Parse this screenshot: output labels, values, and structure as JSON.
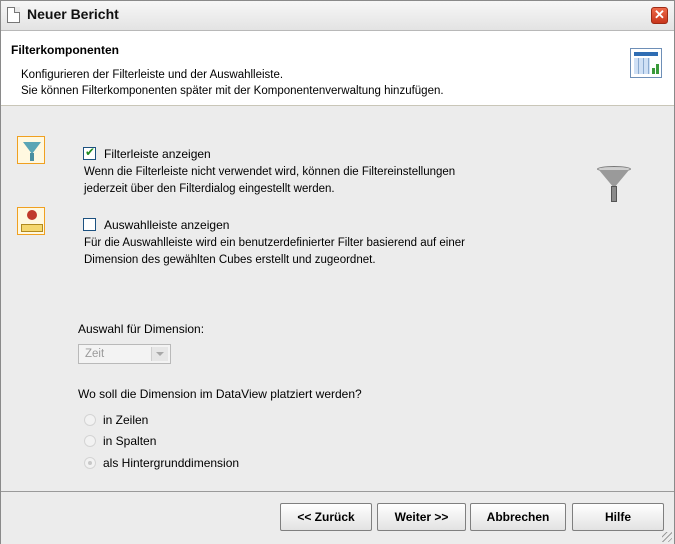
{
  "window": {
    "title": "Neuer Bericht"
  },
  "header": {
    "title": "Filterkomponenten",
    "line1": "Konfigurieren der Filterleiste und der Auswahlleiste.",
    "line2": "Sie können Filterkomponenten später mit der Komponentenverwaltung hinzufügen."
  },
  "options": {
    "filterbar": {
      "label": "Filterleiste anzeigen",
      "checked": true,
      "desc1": "Wenn die Filterleiste nicht verwendet wird, können die Filtereinstellungen",
      "desc2": "jederzeit über den Filterdialog eingestellt werden."
    },
    "selectionbar": {
      "label": "Auswahlleiste anzeigen",
      "checked": false,
      "desc1": "Für die Auswahlleiste wird ein benutzerdefinierter Filter basierend auf einer",
      "desc2": "Dimension des gewählten Cubes erstellt und zugeordnet."
    }
  },
  "dimension": {
    "label": "Auswahl für Dimension:",
    "value": "Zeit",
    "enabled": false
  },
  "placement": {
    "question": "Wo soll die Dimension im DataView platziert werden?",
    "options": [
      "in Zeilen",
      "in Spalten",
      "als Hintergrunddimension"
    ],
    "selected": "als Hintergrunddimension"
  },
  "buttons": {
    "back": "<< Zurück",
    "next": "Weiter >>",
    "cancel": "Abbrechen",
    "help": "Hilfe"
  }
}
